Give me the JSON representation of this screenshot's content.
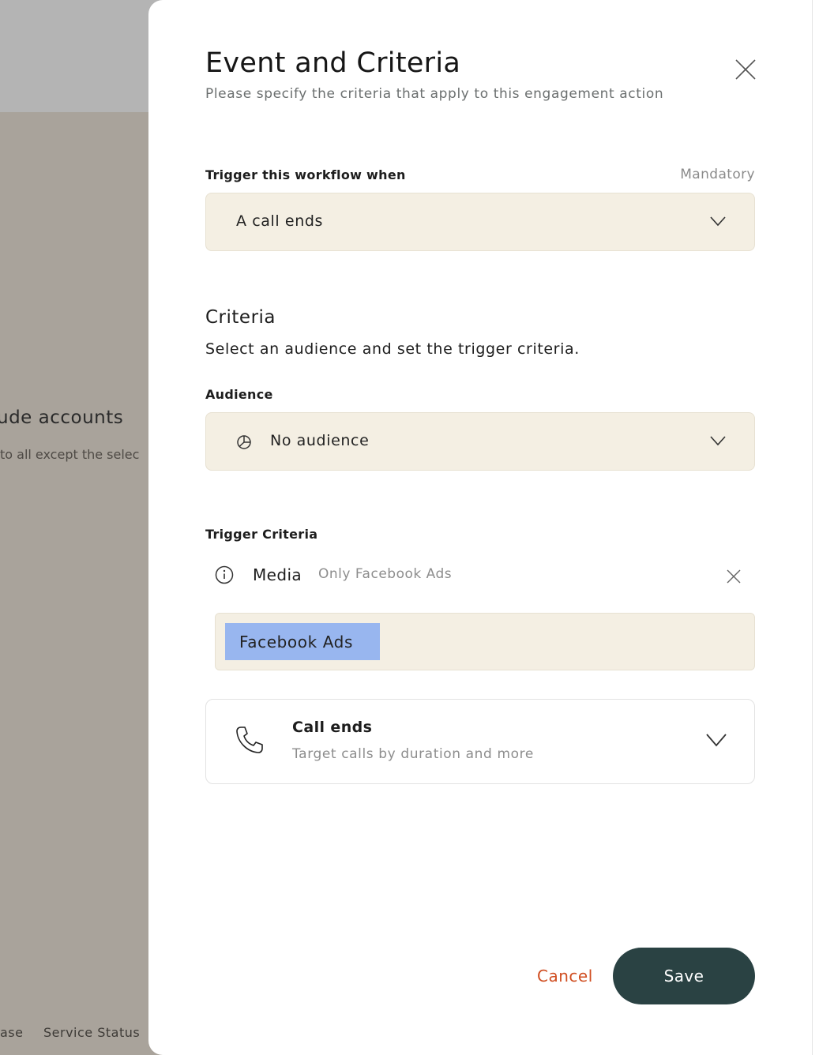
{
  "background": {
    "heading": "ude accounts",
    "subtext": "to all except the selec",
    "footer_left": "ase",
    "footer_right": "Service Status"
  },
  "modal": {
    "title": "Event and Criteria",
    "subtitle": "Please specify the criteria that apply to this engagement action",
    "close_icon": "close-icon"
  },
  "trigger": {
    "label": "Trigger this workflow when",
    "mandatory": "Mandatory",
    "selected": "A call ends"
  },
  "criteria": {
    "title": "Criteria",
    "description": "Select an audience and set the trigger criteria."
  },
  "audience": {
    "label": "Audience",
    "selected": "No audience",
    "icon": "pie-chart-icon"
  },
  "trigger_criteria": {
    "label": "Trigger Criteria",
    "item": {
      "name": "Media",
      "description": "Only Facebook Ads",
      "tag": "Facebook Ads"
    }
  },
  "call_card": {
    "title": "Call ends",
    "subtitle": "Target calls by duration and more",
    "icon": "phone-icon"
  },
  "actions": {
    "cancel": "Cancel",
    "save": "Save"
  },
  "colors": {
    "field_bg": "#f4efe3",
    "chip_bg": "#98b6ef",
    "cancel": "#d04e21",
    "save_bg": "#2a4243"
  }
}
